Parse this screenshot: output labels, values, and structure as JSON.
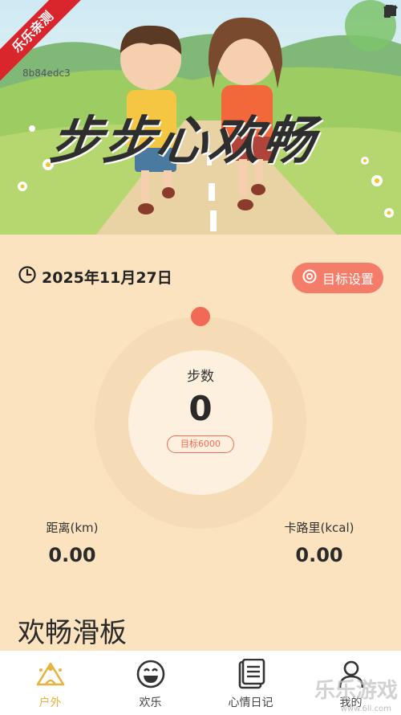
{
  "hero": {
    "title": "步步心欢畅",
    "id_text": "8b84edc3",
    "ribbon": "乐乐亲测"
  },
  "date": {
    "text": "2025年11月27日",
    "icon": "clock-icon"
  },
  "goal_button": {
    "label": "目标设置",
    "icon": "target-icon"
  },
  "steps": {
    "label": "步数",
    "value": "0",
    "target": "目标6000"
  },
  "stats": {
    "distance": {
      "label": "距离(km)",
      "value": "0.00"
    },
    "calories": {
      "label": "卡路里(kcal)",
      "value": "0.00"
    }
  },
  "section": {
    "title": "欢畅滑板"
  },
  "nav": {
    "items": [
      {
        "label": "户外",
        "icon": "outdoor-icon",
        "active": true
      },
      {
        "label": "欢乐",
        "icon": "smile-icon",
        "active": false
      },
      {
        "label": "心情日记",
        "icon": "diary-icon",
        "active": false
      },
      {
        "label": "我的",
        "icon": "profile-icon",
        "active": false
      }
    ]
  },
  "watermark": {
    "text": "乐乐游戏",
    "sub": "www.6ll.com"
  },
  "colors": {
    "accent": "#f47d6a",
    "background": "#fbe3bf",
    "active_nav": "#e8b33c"
  }
}
